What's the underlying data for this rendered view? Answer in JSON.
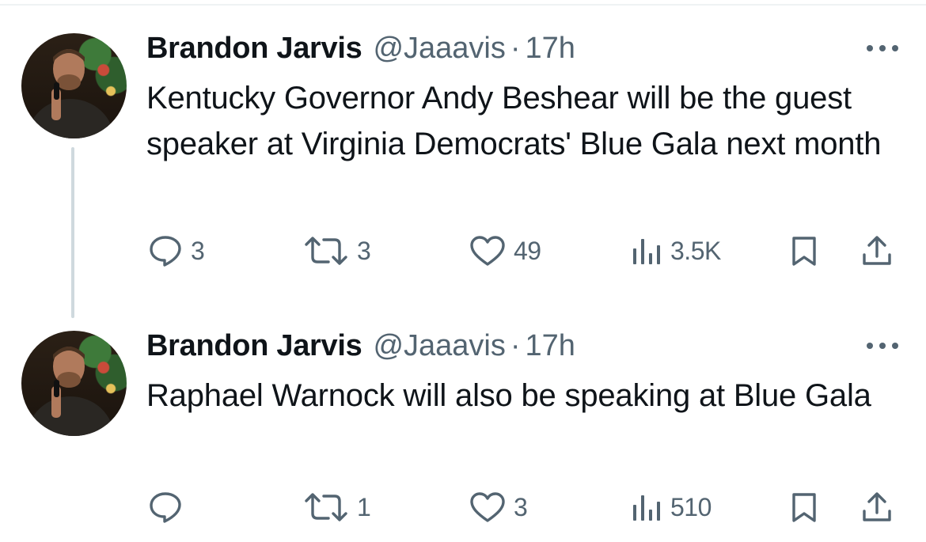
{
  "tweets": [
    {
      "display_name": "Brandon Jarvis",
      "handle": "@Jaaavis",
      "separator": "·",
      "time": "17h",
      "text": "Kentucky Governor Andy Beshear will be the guest speaker at Virginia Democrats' Blue Gala next month",
      "replies": "3",
      "retweets": "3",
      "likes": "49",
      "views": "3.5K"
    },
    {
      "display_name": "Brandon Jarvis",
      "handle": "@Jaaavis",
      "separator": "·",
      "time": "17h",
      "text": "Raphael Warnock will also be speaking at Blue Gala",
      "replies": "",
      "retweets": "1",
      "likes": "3",
      "views": "510"
    }
  ],
  "icons": {
    "reply": "reply-icon",
    "retweet": "retweet-icon",
    "like": "heart-icon",
    "views": "views-icon",
    "bookmark": "bookmark-icon",
    "share": "share-icon",
    "more": "more-icon"
  },
  "colors": {
    "text": "#0f1419",
    "secondary": "#536471",
    "thread_line": "#cfd9de"
  }
}
